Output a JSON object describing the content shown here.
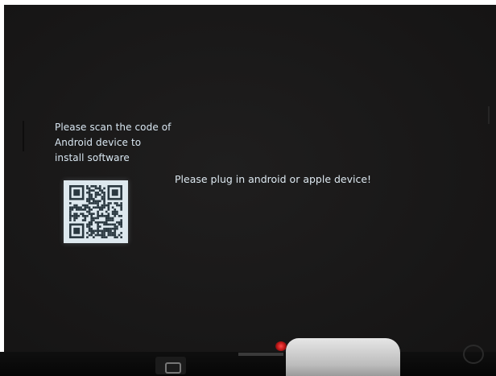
{
  "screen": {
    "scan_prompt_lines": [
      "Please scan the code of",
      "Android device to",
      "install software"
    ],
    "plug_prompt": "Please plug in android or apple device!"
  },
  "colors": {
    "screen_background": "#1a1919",
    "text": "#d9e7f2",
    "qr_background": "#dde8ee",
    "qr_modules": "#2a3840"
  },
  "icons": {
    "qr_code": "qr-code-icon"
  }
}
